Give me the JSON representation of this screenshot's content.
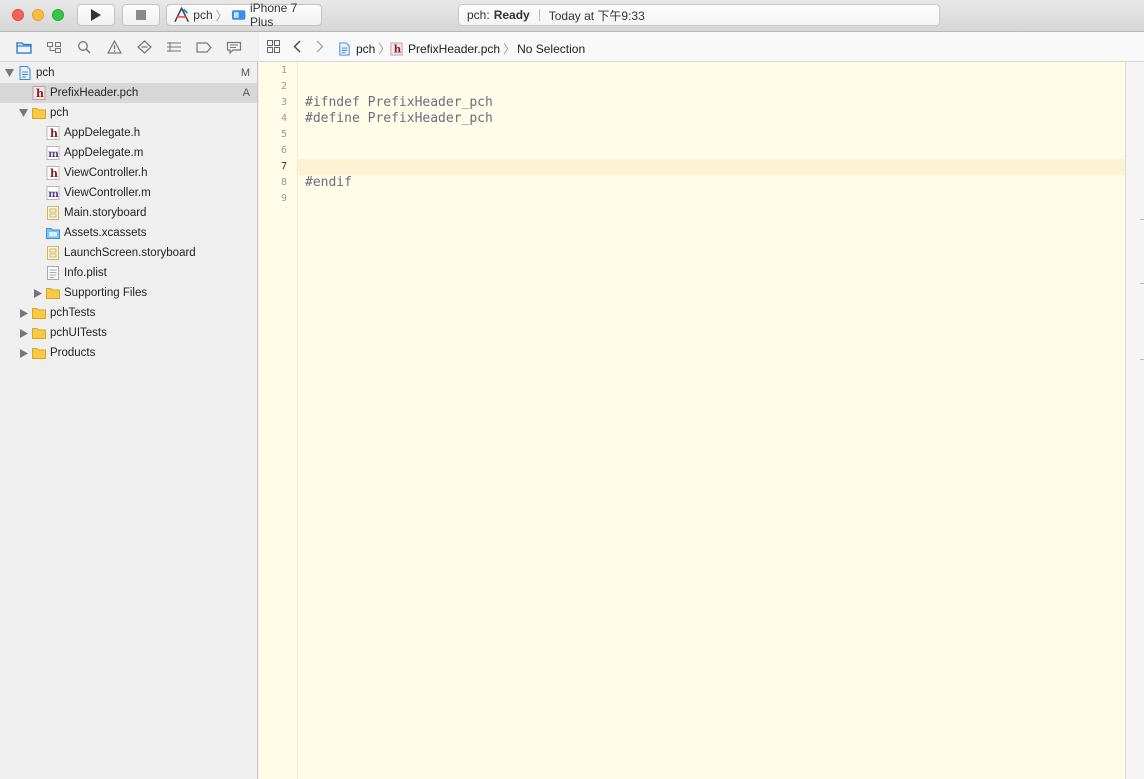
{
  "toolbar": {
    "scheme": {
      "project": "pch",
      "device": "iPhone 7 Plus"
    },
    "status": {
      "project": "pch:",
      "state": "Ready",
      "time": "Today at 下午9:33"
    }
  },
  "navigator": {
    "icons": [
      "folder-icon",
      "source-control-icon",
      "search-icon",
      "warning-icon",
      "test-icon",
      "debug-icon",
      "breakpoint-icon",
      "report-icon"
    ],
    "items": [
      {
        "label": "pch",
        "badge": "M",
        "kind": "project",
        "depth": 0,
        "expanded": true
      },
      {
        "label": "PrefixHeader.pch",
        "badge": "A",
        "kind": "h-file",
        "depth": 1,
        "selected": true
      },
      {
        "label": "pch",
        "badge": "",
        "kind": "folder",
        "depth": 1,
        "expanded": true
      },
      {
        "label": "AppDelegate.h",
        "badge": "",
        "kind": "h-file",
        "depth": 2
      },
      {
        "label": "AppDelegate.m",
        "badge": "",
        "kind": "m-file",
        "depth": 2
      },
      {
        "label": "ViewController.h",
        "badge": "",
        "kind": "h-file",
        "depth": 2
      },
      {
        "label": "ViewController.m",
        "badge": "",
        "kind": "m-file",
        "depth": 2
      },
      {
        "label": "Main.storyboard",
        "badge": "",
        "kind": "storyboard",
        "depth": 2
      },
      {
        "label": "Assets.xcassets",
        "badge": "",
        "kind": "assets",
        "depth": 2
      },
      {
        "label": "LaunchScreen.storyboard",
        "badge": "",
        "kind": "storyboard",
        "depth": 2
      },
      {
        "label": "Info.plist",
        "badge": "",
        "kind": "plist",
        "depth": 2
      },
      {
        "label": "Supporting Files",
        "badge": "",
        "kind": "folder",
        "depth": 2,
        "expanded": false
      },
      {
        "label": "pchTests",
        "badge": "",
        "kind": "folder",
        "depth": 1,
        "expanded": false
      },
      {
        "label": "pchUITests",
        "badge": "",
        "kind": "folder",
        "depth": 1,
        "expanded": false
      },
      {
        "label": "Products",
        "badge": "",
        "kind": "folder",
        "depth": 1,
        "expanded": false
      }
    ]
  },
  "jumpbar": {
    "project": "pch",
    "file": "PrefixHeader.pch",
    "selection": "No Selection"
  },
  "editor": {
    "lines": [
      "1",
      "2",
      "3",
      "4",
      "5",
      "6",
      "7",
      "8",
      "9"
    ],
    "current_line": "7",
    "code": [
      "",
      "",
      "#ifndef PrefixHeader_pch",
      "#define PrefixHeader_pch",
      "",
      "",
      "",
      "#endif",
      ""
    ]
  },
  "colors": {
    "editor_bg": "#fffce8",
    "folder": "#f7c948",
    "h_icon": "#8a1f24",
    "m_icon": "#5a3d8a",
    "directive": "#6c6c85"
  }
}
